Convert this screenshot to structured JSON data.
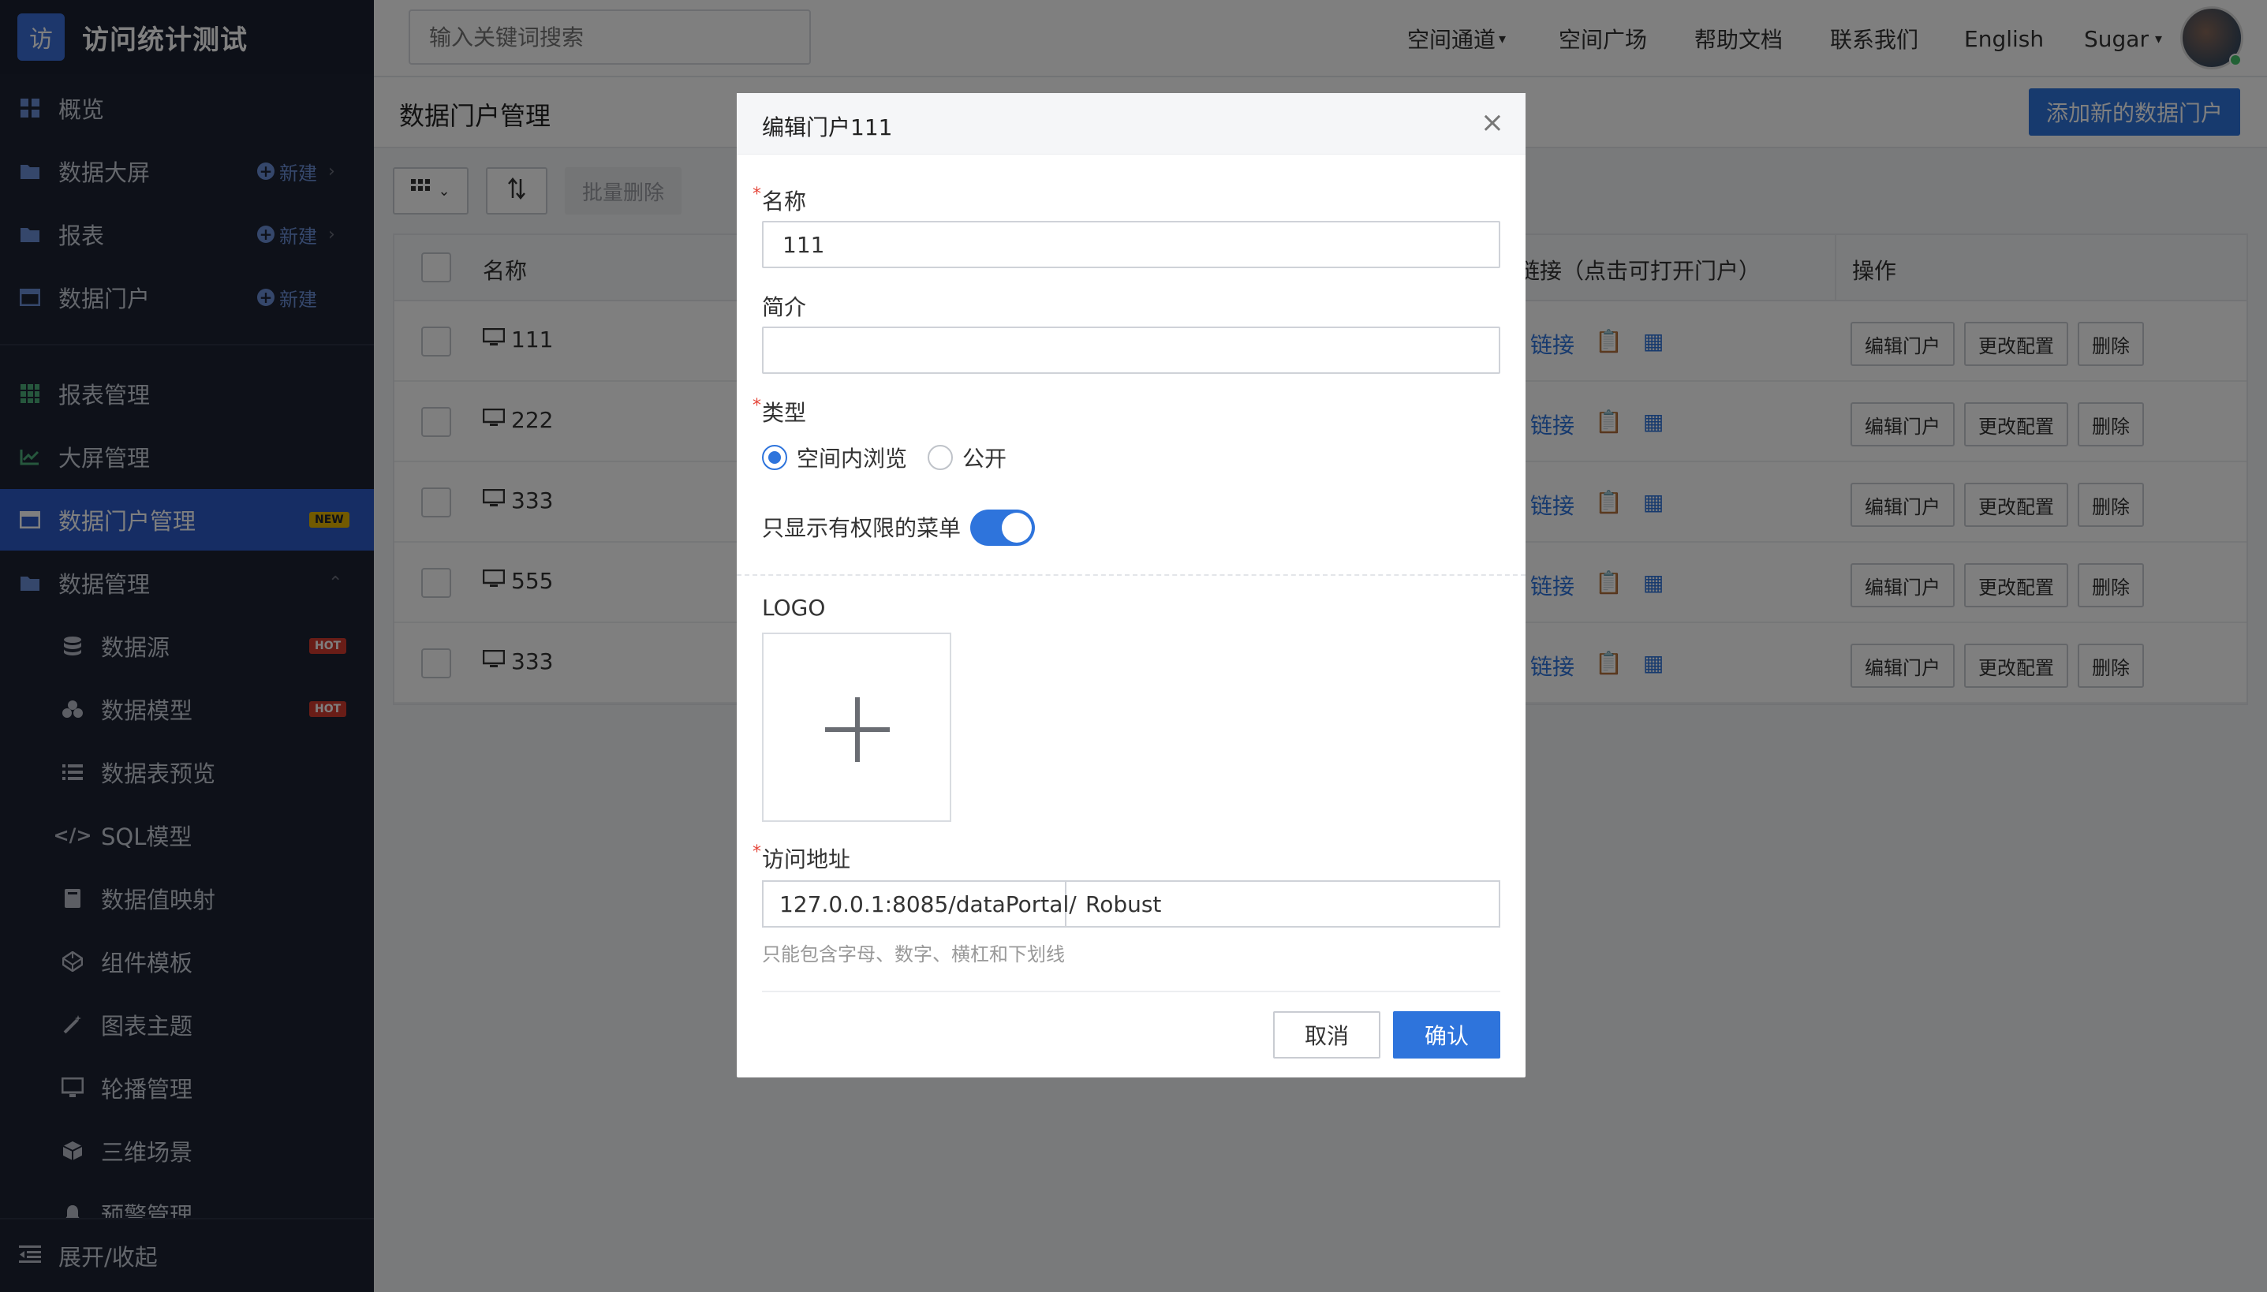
{
  "brand": {
    "logo_char": "访",
    "title": "访问统计测试"
  },
  "sidebar": {
    "new_label": "新建",
    "items": [
      {
        "label": "概览"
      },
      {
        "label": "数据大屏"
      },
      {
        "label": "报表"
      },
      {
        "label": "数据门户"
      },
      {
        "label": "报表管理"
      },
      {
        "label": "大屏管理"
      },
      {
        "label": "数据门户管理",
        "badge": "NEW"
      },
      {
        "label": "数据管理"
      },
      {
        "label": "数据源",
        "badge": "HOT"
      },
      {
        "label": "数据模型",
        "badge": "HOT"
      },
      {
        "label": "数据表预览"
      },
      {
        "label": "SQL模型"
      },
      {
        "label": "数据值映射"
      },
      {
        "label": "组件模板"
      },
      {
        "label": "图表主题"
      },
      {
        "label": "轮播管理"
      },
      {
        "label": "三维场景"
      },
      {
        "label": "预警管理"
      }
    ],
    "footer": "展开/收起"
  },
  "header": {
    "search_placeholder": "输入关键词搜索",
    "nav": [
      "空间通道",
      "空间广场",
      "帮助文档",
      "联系我们",
      "English",
      "Sugar"
    ]
  },
  "page": {
    "title": "数据门户管理",
    "add_button": "添加新的数据门户",
    "batch_delete": "批量删除"
  },
  "table": {
    "headers": {
      "name": "名称",
      "link": "链接（点击可打开门户）",
      "ops": "操作"
    },
    "link_text": "链接",
    "ops": {
      "edit": "编辑门户",
      "config": "更改配置",
      "delete": "删除"
    },
    "rows": [
      {
        "name": "111"
      },
      {
        "name": "222"
      },
      {
        "name": "333"
      },
      {
        "name": "555"
      },
      {
        "name": "333"
      }
    ]
  },
  "modal": {
    "title": "编辑门户111",
    "name_label": "名称",
    "name_value": "111",
    "intro_label": "简介",
    "intro_value": "",
    "type_label": "类型",
    "type_options": [
      "空间内浏览",
      "公开"
    ],
    "type_selected": "空间内浏览",
    "menu_switch_label": "只显示有权限的菜单",
    "menu_switch_on": true,
    "logo_label": "LOGO",
    "address_label": "访问地址",
    "address_prefix": "127.0.0.1:8085/dataPortal/",
    "address_value": "Robust",
    "address_hint": "只能包含字母、数字、横杠和下划线",
    "cancel": "取消",
    "confirm": "确认"
  },
  "colors": {
    "accent": "#2e74dc",
    "sidebar_bg": "#1c2233",
    "badge_new": "#e5b400",
    "badge_hot": "#d23a2e"
  }
}
